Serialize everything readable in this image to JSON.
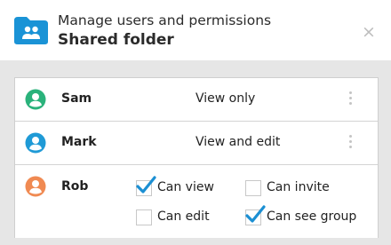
{
  "header": {
    "subtitle": "Manage users and permissions",
    "title": "Shared folder",
    "close_glyph": "×"
  },
  "icons": {
    "folder": "shared-folder-icon",
    "avatar": "user-avatar-icon",
    "more": "more-vertical-icon",
    "check": "checkmark-icon",
    "close": "close-icon"
  },
  "colors": {
    "folder": "#1a93d6",
    "sam": "#2ab27b",
    "mark": "#1f9ad6",
    "rob": "#f08a52",
    "check": "#1b8fd3"
  },
  "users": [
    {
      "name": "Sam",
      "permission": "View only"
    },
    {
      "name": "Mark",
      "permission": "View and edit"
    },
    {
      "name": "Rob",
      "options": [
        {
          "label": "Can view",
          "checked": true
        },
        {
          "label": "Can invite",
          "checked": false
        },
        {
          "label": "Can edit",
          "checked": false
        },
        {
          "label": "Can see group",
          "checked": true
        }
      ]
    }
  ]
}
